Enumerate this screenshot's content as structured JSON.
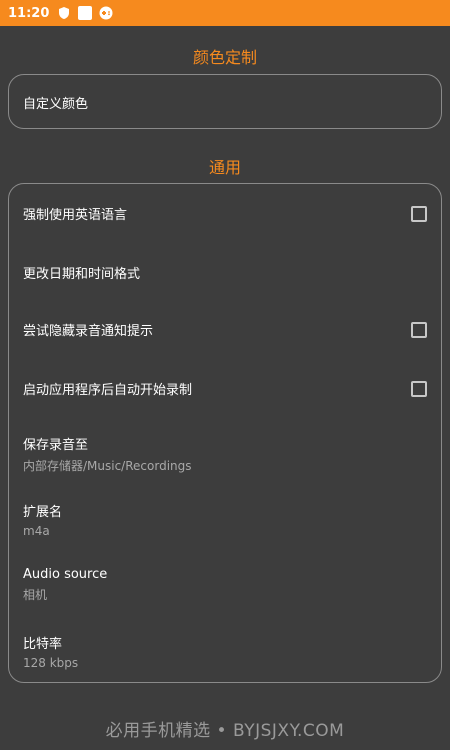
{
  "status_bar": {
    "time": "11:20",
    "icons": [
      "shield-icon",
      "square-icon",
      "game-icon"
    ],
    "color": "#f68a1e"
  },
  "sections": {
    "color": {
      "title": "颜色定制",
      "items": [
        {
          "label": "自定义颜色"
        }
      ]
    },
    "general": {
      "title": "通用",
      "items": [
        {
          "label": "强制使用英语语言",
          "checkbox": true,
          "checked": false
        },
        {
          "label": "更改日期和时间格式"
        },
        {
          "label": "尝试隐藏录音通知提示",
          "checkbox": true,
          "checked": false
        },
        {
          "label": "启动应用程序后自动开始录制",
          "checkbox": true,
          "checked": false
        },
        {
          "label": "保存录音至",
          "value": "内部存储器/Music/Recordings"
        },
        {
          "label": "扩展名",
          "value": "m4a"
        },
        {
          "label": "Audio source",
          "value": "相机"
        },
        {
          "label": "比特率",
          "value": "128 kbps"
        }
      ]
    }
  },
  "watermark": "必用手机精选 • BYJSJXY.COM"
}
